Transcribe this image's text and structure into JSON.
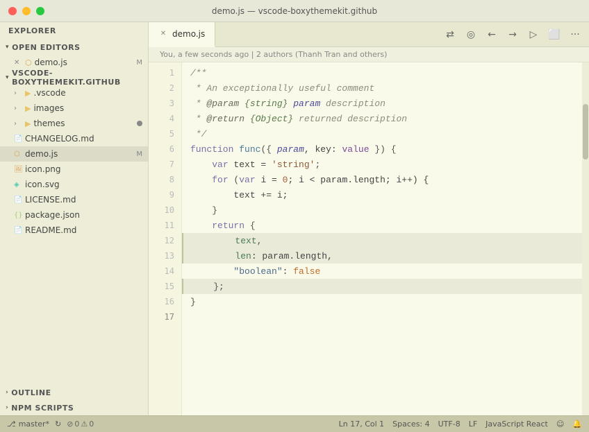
{
  "titleBar": {
    "title": "demo.js — vscode-boxythemekit.github"
  },
  "sidebar": {
    "explorerLabel": "EXPLORER",
    "openEditorsLabel": "OPEN EDITORS",
    "rootLabel": "VSCODE-BOXYTHEMEKIT.GITHUB",
    "openFiles": [
      {
        "name": "demo.js",
        "modified": "M",
        "icon": "js"
      }
    ],
    "treeItems": [
      {
        "name": ".vscode",
        "type": "folder",
        "indent": 1
      },
      {
        "name": "images",
        "type": "folder",
        "indent": 1
      },
      {
        "name": "themes",
        "type": "folder",
        "indent": 1,
        "hasDot": true
      },
      {
        "name": "CHANGELOG.md",
        "type": "md",
        "indent": 1
      },
      {
        "name": "demo.js",
        "type": "js",
        "indent": 1,
        "modified": "M",
        "active": true
      },
      {
        "name": "icon.png",
        "type": "png",
        "indent": 1
      },
      {
        "name": "icon.svg",
        "type": "svg",
        "indent": 1
      },
      {
        "name": "LICENSE.md",
        "type": "md",
        "indent": 1
      },
      {
        "name": "package.json",
        "type": "json",
        "indent": 1
      },
      {
        "name": "README.md",
        "type": "md",
        "indent": 1
      }
    ],
    "outlineLabel": "OUTLINE",
    "npmScriptsLabel": "NPM SCRIPTS"
  },
  "editor": {
    "tabName": "demo.js",
    "blameText": "You, a few seconds ago | 2 authors (Thanh Tran and others)",
    "lines": [
      {
        "num": 1,
        "tokens": [
          {
            "t": "/**",
            "c": "c-comment"
          }
        ]
      },
      {
        "num": 2,
        "tokens": [
          {
            "t": " * An exceptionally useful comment",
            "c": "c-comment"
          }
        ]
      },
      {
        "num": 3,
        "tokens": [
          {
            "t": " * ",
            "c": "c-comment"
          },
          {
            "t": "@param",
            "c": "c-comment"
          },
          {
            "t": " {string} ",
            "c": "c-type"
          },
          {
            "t": "param",
            "c": "c-param"
          },
          {
            "t": " description",
            "c": "c-comment"
          }
        ]
      },
      {
        "num": 4,
        "tokens": [
          {
            "t": " * ",
            "c": "c-comment"
          },
          {
            "t": "@return",
            "c": "c-comment"
          },
          {
            "t": " {Object} ",
            "c": "c-type"
          },
          {
            "t": "returned description",
            "c": "c-comment"
          }
        ]
      },
      {
        "num": 5,
        "tokens": [
          {
            "t": " */",
            "c": "c-comment"
          }
        ]
      },
      {
        "num": 6,
        "tokens": [
          {
            "t": "function",
            "c": "c-keyword"
          },
          {
            "t": " ",
            "c": "c-plain"
          },
          {
            "t": "func",
            "c": "c-func"
          },
          {
            "t": "({",
            "c": "c-punct"
          },
          {
            "t": " ",
            "c": "c-plain"
          },
          {
            "t": "param",
            "c": "c-param"
          },
          {
            "t": ", key: ",
            "c": "c-plain"
          },
          {
            "t": "value",
            "c": "c-value"
          },
          {
            "t": " }) {",
            "c": "c-punct"
          }
        ]
      },
      {
        "num": 7,
        "tokens": [
          {
            "t": "    ",
            "c": "c-plain"
          },
          {
            "t": "var",
            "c": "c-keyword"
          },
          {
            "t": " ",
            "c": "c-plain"
          },
          {
            "t": "text",
            "c": "c-plain"
          },
          {
            "t": " = ",
            "c": "c-plain"
          },
          {
            "t": "'string'",
            "c": "c-string"
          },
          {
            "t": ";",
            "c": "c-punct"
          }
        ]
      },
      {
        "num": 8,
        "tokens": [
          {
            "t": "    ",
            "c": "c-plain"
          },
          {
            "t": "for",
            "c": "c-keyword"
          },
          {
            "t": " (",
            "c": "c-punct"
          },
          {
            "t": "var",
            "c": "c-keyword"
          },
          {
            "t": " i = ",
            "c": "c-plain"
          },
          {
            "t": "0",
            "c": "c-number"
          },
          {
            "t": "; i < param.length; i++) {",
            "c": "c-plain"
          }
        ]
      },
      {
        "num": 9,
        "tokens": [
          {
            "t": "        ",
            "c": "c-plain"
          },
          {
            "t": "text",
            "c": "c-plain"
          },
          {
            "t": " += i;",
            "c": "c-plain"
          }
        ]
      },
      {
        "num": 10,
        "tokens": [
          {
            "t": "    }",
            "c": "c-punct"
          }
        ]
      },
      {
        "num": 11,
        "tokens": [
          {
            "t": "    ",
            "c": "c-plain"
          },
          {
            "t": "return",
            "c": "c-keyword"
          },
          {
            "t": " {",
            "c": "c-punct"
          }
        ]
      },
      {
        "num": 12,
        "tokens": [
          {
            "t": "        ",
            "c": "c-plain"
          },
          {
            "t": "text",
            "c": "c-property"
          },
          {
            "t": ",",
            "c": "c-punct"
          }
        ],
        "highlighted": true
      },
      {
        "num": 13,
        "tokens": [
          {
            "t": "        ",
            "c": "c-plain"
          },
          {
            "t": "len",
            "c": "c-property"
          },
          {
            "t": ": param.length,",
            "c": "c-plain"
          }
        ],
        "highlighted": true
      },
      {
        "num": 14,
        "tokens": [
          {
            "t": "        ",
            "c": "c-plain"
          },
          {
            "t": "\"boolean\"",
            "c": "c-key"
          },
          {
            "t": ": ",
            "c": "c-plain"
          },
          {
            "t": "false",
            "c": "c-false"
          }
        ]
      },
      {
        "num": 15,
        "tokens": [
          {
            "t": "    };",
            "c": "c-punct"
          }
        ],
        "highlighted": true
      },
      {
        "num": 16,
        "tokens": [
          {
            "t": "}",
            "c": "c-punct"
          }
        ]
      },
      {
        "num": 17,
        "tokens": []
      }
    ]
  },
  "statusBar": {
    "branch": "master*",
    "syncIcon": "↻",
    "warnings": "0",
    "errors": "0",
    "lineCol": "Ln 17, Col 1",
    "spaces": "Spaces: 4",
    "encoding": "UTF-8",
    "lineEnding": "LF",
    "language": "JavaScript React",
    "smileyIcon": "☺",
    "bellIcon": "🔔"
  }
}
